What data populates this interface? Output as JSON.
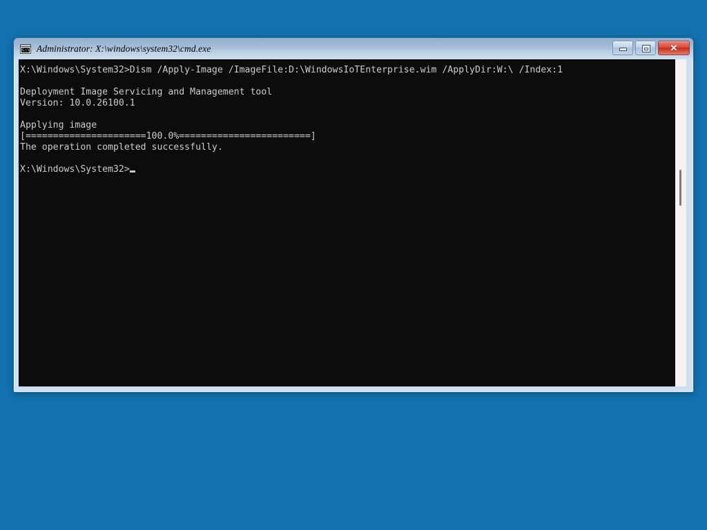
{
  "desktop": {
    "background_color": "#1271ae"
  },
  "window": {
    "title": "Administrator: X:\\windows\\system32\\cmd.exe",
    "icon": "cmd-console-icon",
    "icon_glyph": "C:\\_",
    "frame_color": "#bfd4e9",
    "titlebar_gradient_top": "#93aecd",
    "titlebar_gradient_bottom": "#cfe0f0",
    "controls": {
      "minimize_label": "Minimize",
      "maximize_label": "Restore",
      "close_label": "Close",
      "close_glyph": "✕",
      "close_color": "#c62e20"
    }
  },
  "console": {
    "background_color": "#0c0c0c",
    "text_color": "#cccccc",
    "cursor": "_",
    "scrollbar": {
      "track_color": "#f5f0f3",
      "thumb_color": "#7d7d7d"
    },
    "lines": [
      "X:\\Windows\\System32>Dism /Apply-Image /ImageFile:D:\\WindowsIoTEnterprise.wim /ApplyDir:W:\\ /Index:1",
      "",
      "Deployment Image Servicing and Management tool",
      "Version: 10.0.26100.1",
      "",
      "Applying image",
      "[======================100.0%========================]",
      "The operation completed successfully.",
      "",
      "X:\\Windows\\System32>"
    ]
  }
}
